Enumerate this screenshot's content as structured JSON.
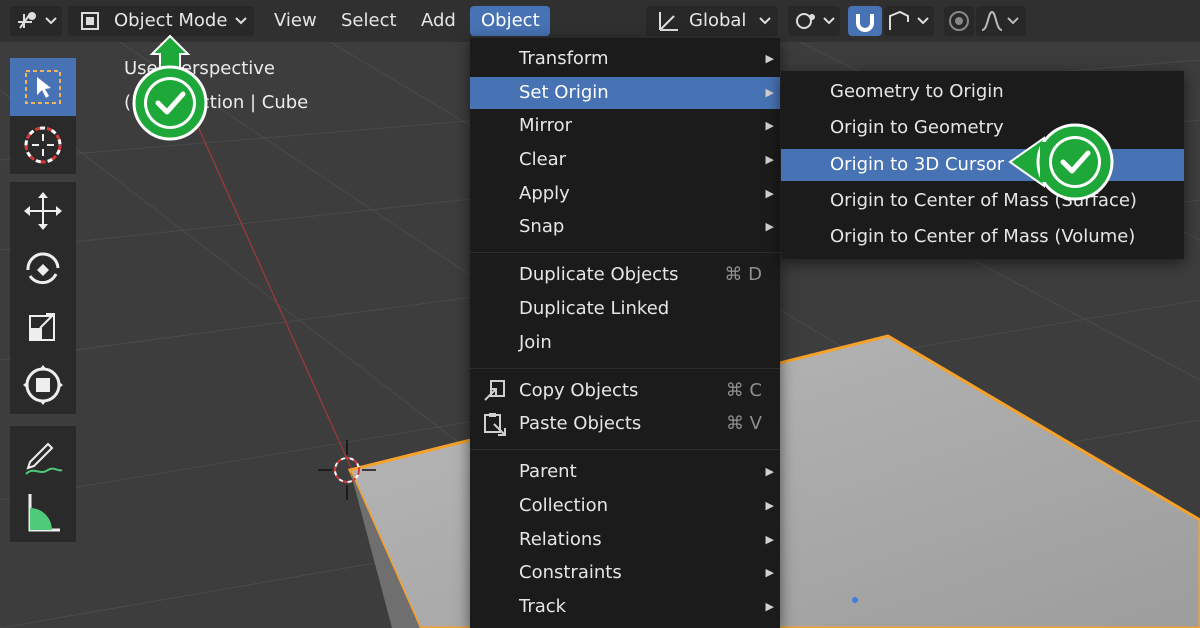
{
  "header": {
    "mode_label": "Object Mode",
    "menus": [
      "View",
      "Select",
      "Add",
      "Object"
    ],
    "transform_orientation": "Global"
  },
  "overlay": {
    "view_label": "User Perspective",
    "collection_label": "(1) Collection | Cube"
  },
  "object_menu": {
    "items": [
      {
        "label": "Transform",
        "shortcut": "",
        "submenu": true
      },
      {
        "label": "Set Origin",
        "shortcut": "",
        "submenu": true,
        "highlighted": true
      },
      {
        "label": "Mirror",
        "shortcut": "",
        "submenu": true
      },
      {
        "label": "Clear",
        "shortcut": "",
        "submenu": true
      },
      {
        "label": "Apply",
        "shortcut": "",
        "submenu": true
      },
      {
        "label": "Snap",
        "shortcut": "",
        "submenu": true
      },
      {
        "label": "Duplicate Objects",
        "shortcut": "⌘ D",
        "submenu": false
      },
      {
        "label": "Duplicate Linked",
        "shortcut": "",
        "submenu": false
      },
      {
        "label": "Join",
        "shortcut": "",
        "submenu": false
      },
      {
        "label": "Copy Objects",
        "shortcut": "⌘ C",
        "submenu": false
      },
      {
        "label": "Paste Objects",
        "shortcut": "⌘ V",
        "submenu": false
      },
      {
        "label": "Parent",
        "shortcut": "",
        "submenu": true
      },
      {
        "label": "Collection",
        "shortcut": "",
        "submenu": true
      },
      {
        "label": "Relations",
        "shortcut": "",
        "submenu": true
      },
      {
        "label": "Constraints",
        "shortcut": "",
        "submenu": true
      },
      {
        "label": "Track",
        "shortcut": "",
        "submenu": true
      }
    ]
  },
  "set_origin_submenu": {
    "items": [
      {
        "label": "Geometry to Origin"
      },
      {
        "label": "Origin to Geometry"
      },
      {
        "label": "Origin to 3D Cursor",
        "highlighted": true
      },
      {
        "label": "Origin to Center of Mass (Surface)"
      },
      {
        "label": "Origin to Center of Mass (Volume)"
      }
    ]
  },
  "colors": {
    "accent": "#4772b3",
    "badge": "#1ea83a",
    "selection_outline": "#f5a12b"
  },
  "icons": {
    "toolbar": [
      "select-box-icon",
      "cursor-icon",
      "move-icon",
      "rotate-icon",
      "scale-icon",
      "transform-icon",
      "annotate-icon",
      "measure-icon"
    ],
    "badges": [
      "checkmark-icon",
      "checkmark-icon"
    ]
  }
}
